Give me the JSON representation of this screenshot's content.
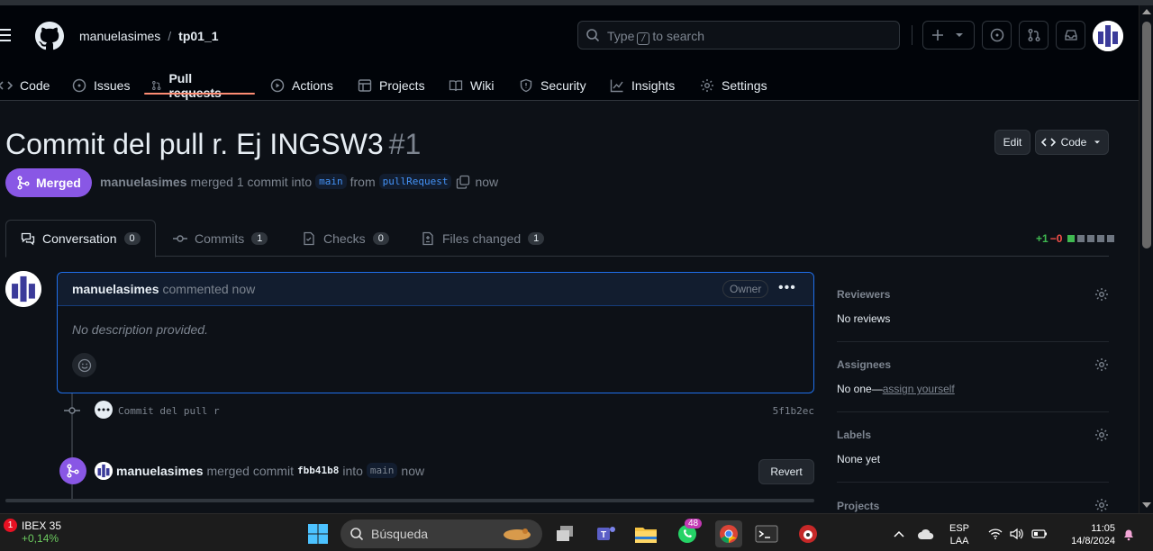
{
  "header": {
    "owner": "manuelasimes",
    "separator": "/",
    "repo": "tp01_1",
    "search_prefix": "Type",
    "search_key": "/",
    "search_suffix": "to search"
  },
  "nav": {
    "items": [
      {
        "label": "Code",
        "icon": "code-icon"
      },
      {
        "label": "Issues",
        "icon": "issue-opened-icon"
      },
      {
        "label": "Pull requests",
        "icon": "git-pull-request-icon"
      },
      {
        "label": "Actions",
        "icon": "play-icon"
      },
      {
        "label": "Projects",
        "icon": "table-icon"
      },
      {
        "label": "Wiki",
        "icon": "book-icon"
      },
      {
        "label": "Security",
        "icon": "shield-icon"
      },
      {
        "label": "Insights",
        "icon": "graph-icon"
      },
      {
        "label": "Settings",
        "icon": "gear-icon"
      }
    ],
    "active": "Pull requests"
  },
  "pr": {
    "title": "Commit del pull r. Ej INGSW3",
    "number": "#1",
    "edit_label": "Edit",
    "code_label": "Code",
    "state": "Merged",
    "author": "manuelasimes",
    "merge_text": "merged 1 commit into",
    "base_branch": "main",
    "from_text": "from",
    "head_branch": "pullRequest",
    "time": "now"
  },
  "tabs": [
    {
      "label": "Conversation",
      "count": "0",
      "icon": "comment-discussion-icon"
    },
    {
      "label": "Commits",
      "count": "1",
      "icon": "git-commit-icon"
    },
    {
      "label": "Checks",
      "count": "0",
      "icon": "checklist-icon"
    },
    {
      "label": "Files changed",
      "count": "1",
      "icon": "file-diff-icon"
    }
  ],
  "diffstat": {
    "additions": "+1",
    "deletions": "−0",
    "colors": [
      "#3fb950",
      "#6e7681",
      "#6e7681",
      "#6e7681",
      "#6e7681"
    ]
  },
  "comment": {
    "author": "manuelasimes",
    "action": "commented now",
    "badge": "Owner",
    "body": "No description provided."
  },
  "commit": {
    "message": "Commit del pull r",
    "sha": "5f1b2ec"
  },
  "merge_event": {
    "author": "manuelasimes",
    "text": "merged commit",
    "sha": "fbb41b8",
    "into": "into",
    "branch": "main",
    "time": "now",
    "revert_label": "Revert"
  },
  "sidebar": {
    "reviewers": {
      "title": "Reviewers",
      "value": "No reviews"
    },
    "assignees": {
      "title": "Assignees",
      "value": "No one—",
      "link": "assign yourself"
    },
    "labels": {
      "title": "Labels",
      "value": "None yet"
    },
    "projects": {
      "title": "Projects"
    }
  },
  "taskbar": {
    "stock_name": "IBEX 35",
    "stock_change": "+0,14%",
    "stock_badge": "1",
    "search_label": "Búsqueda",
    "whatsapp_badge": "48",
    "lang_1": "ESP",
    "lang_2": "LAA",
    "time": "11:05",
    "date": "14/8/2024"
  },
  "colors": {
    "accent_merged": "#8957e5",
    "link": "#4493f8",
    "underline": "#fd8c73",
    "bg": "#0d1117"
  }
}
